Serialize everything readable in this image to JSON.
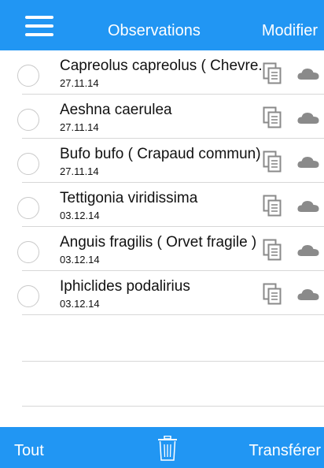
{
  "header": {
    "title": "Observations",
    "modify_label": "Modifier"
  },
  "observations": [
    {
      "name": "Capreolus capreolus  ( Chevre...",
      "date": "27.11.14"
    },
    {
      "name": "Aeshna caerulea",
      "date": "27.11.14"
    },
    {
      "name": "Bufo bufo  ( Crapaud commun)",
      "date": "27.11.14"
    },
    {
      "name": "Tettigonia viridissima",
      "date": "03.12.14"
    },
    {
      "name": "Anguis fragilis  ( Orvet fragile )",
      "date": "03.12.14"
    },
    {
      "name": "Iphiclides podalirius",
      "date": "03.12.14"
    }
  ],
  "footer": {
    "select_all_label": "Tout",
    "transfer_label": "Transférer"
  },
  "colors": {
    "bar": "#2196f3",
    "icon": "#8a8a8a"
  }
}
